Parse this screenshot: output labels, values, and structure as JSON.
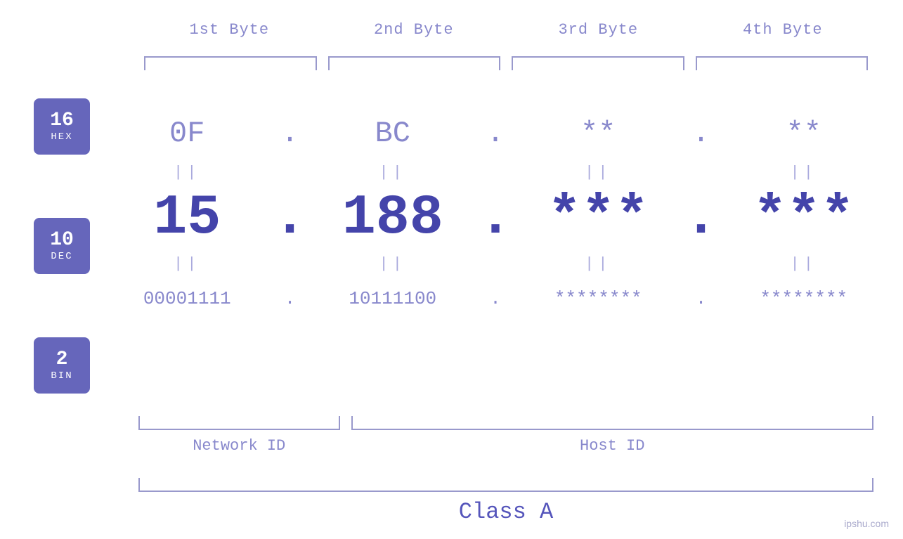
{
  "headers": {
    "byte1": "1st Byte",
    "byte2": "2nd Byte",
    "byte3": "3rd Byte",
    "byte4": "4th Byte"
  },
  "bases": [
    {
      "num": "16",
      "name": "HEX"
    },
    {
      "num": "10",
      "name": "DEC"
    },
    {
      "num": "2",
      "name": "BIN"
    }
  ],
  "hex_row": {
    "b1": "0F",
    "b2": "BC",
    "b3": "**",
    "b4": "**",
    "dot": "."
  },
  "dec_row": {
    "b1": "15",
    "b2": "188",
    "b3": "***",
    "b4": "***",
    "dot": "."
  },
  "bin_row": {
    "b1": "00001111",
    "b2": "10111100",
    "b3": "********",
    "b4": "********",
    "dot": "."
  },
  "labels": {
    "network_id": "Network ID",
    "host_id": "Host ID",
    "class": "Class A"
  },
  "watermark": "ipshu.com",
  "eq_symbol": "||"
}
